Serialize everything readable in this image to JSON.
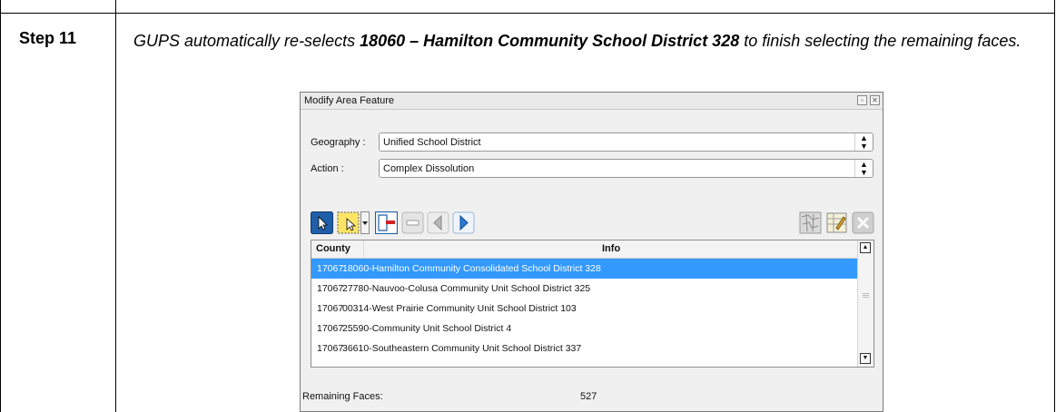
{
  "step": {
    "label": "Step 11",
    "text_pre": "GUPS automatically re-selects ",
    "text_bold": "18060 – Hamilton Community School District 328",
    "text_post": " to finish selecting the remaining faces."
  },
  "dialog": {
    "title": "Modify Area Feature",
    "geography_label": "Geography :",
    "geography_value": "Unified School District",
    "action_label": "Action :",
    "action_value": "Complex Dissolution",
    "table": {
      "headers": [
        "County",
        "Info"
      ],
      "rows": [
        {
          "county": "17067",
          "info": "18060-Hamilton Community Consolidated School District 328",
          "selected": true
        },
        {
          "county": "17067",
          "info": "27780-Nauvoo-Colusa Community Unit School District 325"
        },
        {
          "county": "17067",
          "info": "00314-West Prairie Community Unit School District 103"
        },
        {
          "county": "17067",
          "info": "25590-Community Unit School District 4"
        },
        {
          "county": "17067",
          "info": "36610-Southeastern Community Unit School District 337"
        }
      ]
    },
    "remaining_label": "Remaining Faces:",
    "remaining_value": "527",
    "colors": {
      "selection": "#3399ff"
    },
    "toolbar_icons": [
      "select-feature-icon",
      "rectangle-select-icon",
      "dropdown-arrow-icon",
      "remove-face-icon",
      "minus-icon",
      "previous-icon",
      "next-icon",
      "map-icon",
      "edit-table-icon",
      "close-icon"
    ]
  }
}
